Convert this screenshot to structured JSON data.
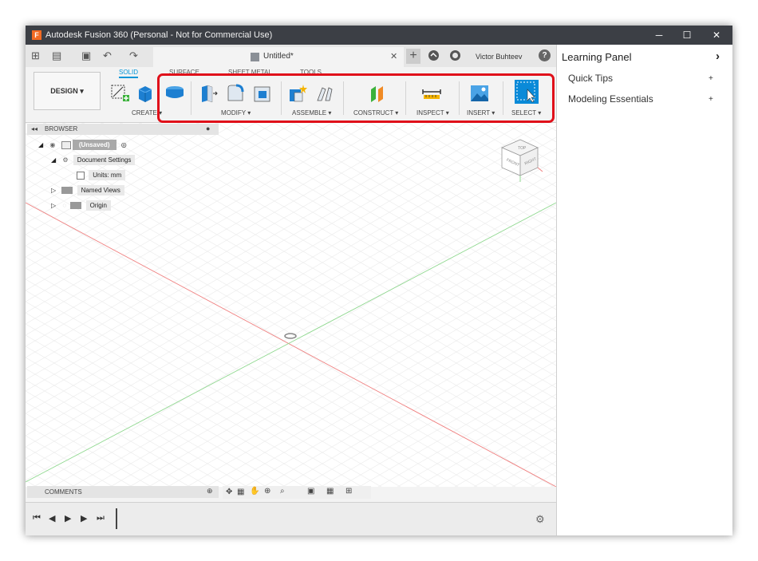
{
  "window": {
    "title": "Autodesk Fusion 360 (Personal - Not for Commercial Use)",
    "app_icon_letter": "F",
    "minimize": "─",
    "maximize": "☐",
    "close": "✕"
  },
  "quick_access": {
    "grid_icon": "⊞",
    "file_icon": "▤",
    "save_icon": "▣",
    "undo_icon": "↶",
    "redo_icon": "↷"
  },
  "document": {
    "title": "Untitled*",
    "close": "✕",
    "new_tab": "+"
  },
  "user": {
    "name": "Victor Buhteev",
    "help": "?"
  },
  "ribbon": {
    "workspace": "DESIGN ▾",
    "tabs": [
      "SOLID",
      "SURFACE",
      "SHEET METAL",
      "TOOLS"
    ],
    "groups": [
      "CREATE ▾",
      "MODIFY ▾",
      "ASSEMBLE ▾",
      "CONSTRUCT ▾",
      "INSPECT ▾",
      "INSERT ▾",
      "SELECT ▾"
    ]
  },
  "browser": {
    "title": "BROWSER",
    "items": [
      {
        "label": "(Unsaved)"
      },
      {
        "label": "Document Settings"
      },
      {
        "label": "Units: mm"
      },
      {
        "label": "Named Views"
      },
      {
        "label": "Origin"
      }
    ]
  },
  "viewcube": {
    "top": "TOP",
    "front": "FRONT",
    "right": "RIGHT"
  },
  "comments": {
    "title": "COMMENTS"
  },
  "learning_panel": {
    "title": "Learning Panel",
    "arrow": "›",
    "items": [
      {
        "label": "Quick Tips",
        "plus": "+"
      },
      {
        "label": "Modeling Essentials",
        "plus": "+"
      }
    ]
  },
  "colors": {
    "titlebar": "#3c3f45",
    "accent": "#0696d7",
    "highlight": "#e0101a",
    "x_axis": "#f08080",
    "y_axis": "#90d890"
  }
}
